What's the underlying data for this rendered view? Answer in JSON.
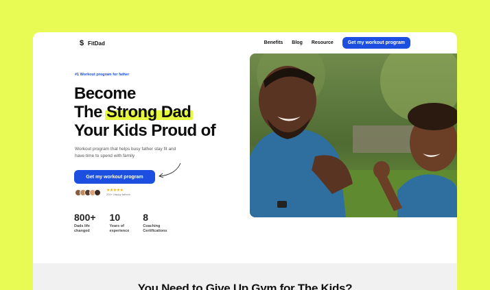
{
  "brand": {
    "name": "FitDad"
  },
  "nav": {
    "links": [
      "Benefits",
      "Blog",
      "Resource"
    ],
    "cta": "Get my workout program"
  },
  "hero": {
    "tag": "#1 Workout program for father",
    "title_line1": "Become",
    "title_line2_prefix": "The ",
    "title_line2_highlight": "Strong Dad",
    "title_line3": "Your Kids Proud of",
    "subtitle": "Workout program that helps busy father stay fit and have time to spend with family",
    "cta": "Get my workout program",
    "stars": "★★★★★",
    "rating_text": "200+ Happy fathers",
    "accent_color": "#1c4fe0",
    "highlight_color": "#e6fb3d"
  },
  "stats": [
    {
      "number": "800+",
      "label_line1": "Dads life",
      "label_line2": "changed"
    },
    {
      "number": "10",
      "label_line1": "Years of",
      "label_line2": "experience"
    },
    {
      "number": "8",
      "label_line1": "Coaching",
      "label_line2": "Certifications"
    }
  ],
  "section2": {
    "title": "You Need to Give Up Gym for The Kids?"
  },
  "icons": {
    "logo": "dollar-s-logo-icon",
    "arrow": "curved-arrow-icon"
  },
  "colors": {
    "page_bg": "#e8fb55",
    "card_bg": "#ffffff",
    "section_bg": "#f1f1f1"
  }
}
